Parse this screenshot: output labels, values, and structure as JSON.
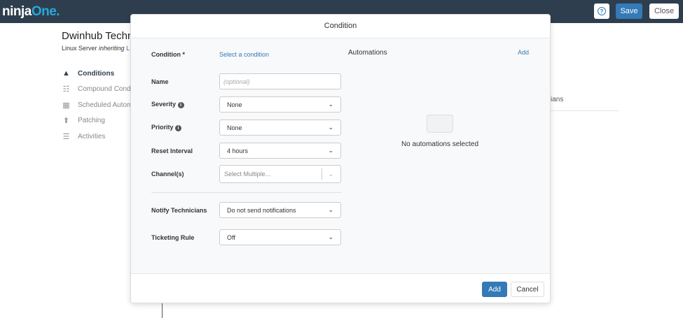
{
  "topbar": {
    "logo_a": "ninja",
    "logo_b": "One",
    "logo_dot": ".",
    "help_icon": "question-circle-icon",
    "save": "Save",
    "close": "Close"
  },
  "device": {
    "title": "Dwinhub Techn",
    "type": "Linux Server ",
    "inheriting": "inheriting",
    "policy": "L"
  },
  "nav": [
    {
      "label": "Conditions",
      "icon": "warning-icon"
    },
    {
      "label": "Compound Condit",
      "icon": "list-tree-icon"
    },
    {
      "label": "Scheduled Autom",
      "icon": "calendar-icon"
    },
    {
      "label": "Patching",
      "icon": "arrow-up-circle-icon"
    },
    {
      "label": "Activities",
      "icon": "list-icon"
    }
  ],
  "background": {
    "col_fragment": "ians"
  },
  "modal": {
    "title": "Condition",
    "condition_label": "Condition *",
    "condition_link": "Select a condition",
    "name_label": "Name",
    "name_placeholder": "(optional)",
    "severity_label": "Severity",
    "severity_value": "None",
    "priority_label": "Priority",
    "priority_value": "None",
    "reset_label": "Reset Interval",
    "reset_value": "4 hours",
    "channels_label": "Channel(s)",
    "channels_placeholder": "Select Multiple...",
    "notify_label": "Notify Technicians",
    "notify_value": "Do not send notifications",
    "ticketing_label": "Ticketing Rule",
    "ticketing_value": "Off",
    "automations_title": "Automations",
    "automations_add": "Add",
    "automations_empty": "No automations selected",
    "add": "Add",
    "cancel": "Cancel"
  }
}
